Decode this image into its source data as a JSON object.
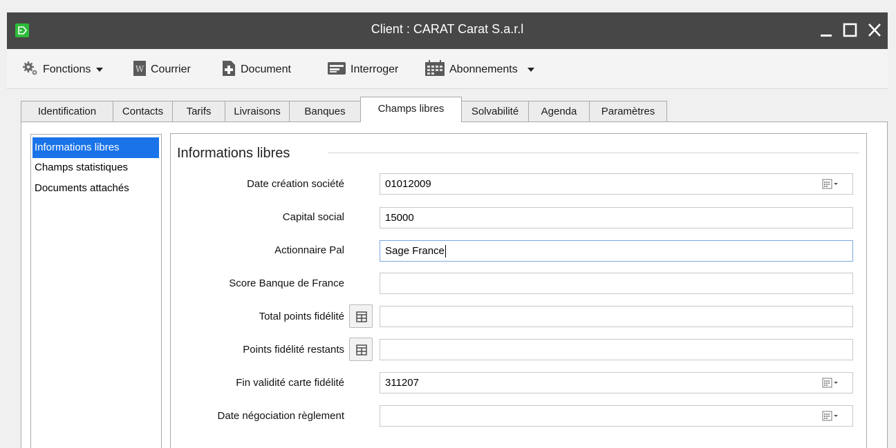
{
  "window": {
    "title": "Client : CARAT Carat S.a.r.l"
  },
  "toolbar": {
    "items": [
      {
        "label": "Fonctions",
        "icon": "gears-icon",
        "dropdown": true
      },
      {
        "label": "Courrier",
        "icon": "word-doc-icon",
        "dropdown": false
      },
      {
        "label": "Document",
        "icon": "new-document-icon",
        "dropdown": false
      },
      {
        "label": "Interroger",
        "icon": "query-icon",
        "dropdown": false
      },
      {
        "label": "Abonnements",
        "icon": "calendar-subscriptions-icon",
        "dropdown": true
      }
    ]
  },
  "tabs": [
    {
      "label": "Identification",
      "active": false
    },
    {
      "label": "Contacts",
      "active": false
    },
    {
      "label": "Tarifs",
      "active": false
    },
    {
      "label": "Livraisons",
      "active": false
    },
    {
      "label": "Banques",
      "active": false
    },
    {
      "label": "Champs libres",
      "active": true
    },
    {
      "label": "Solvabilité",
      "active": false
    },
    {
      "label": "Agenda",
      "active": false
    },
    {
      "label": "Paramètres",
      "active": false
    }
  ],
  "side_list": [
    {
      "label": "Informations libres",
      "selected": true
    },
    {
      "label": "Champs statistiques",
      "selected": false
    },
    {
      "label": "Documents attachés",
      "selected": false
    }
  ],
  "panel": {
    "group_title": "Informations libres",
    "fields": [
      {
        "label": "Date création société",
        "value": "01012009",
        "type": "date"
      },
      {
        "label": "Capital social",
        "value": "15000",
        "type": "text"
      },
      {
        "label": "Actionnaire Pal",
        "value": "Sage France",
        "type": "text",
        "focused": true
      },
      {
        "label": "Score Banque de France",
        "value": "",
        "type": "text"
      },
      {
        "label": "Total points fidélité",
        "value": "",
        "type": "calc"
      },
      {
        "label": "Points fidélité restants",
        "value": "",
        "type": "calc"
      },
      {
        "label": "Fin validité carte fidélité",
        "value": "311207",
        "type": "date"
      },
      {
        "label": "Date négociation règlement",
        "value": "",
        "type": "date"
      }
    ]
  },
  "colors": {
    "titlebar": "#474747",
    "selection": "#1a73e8",
    "app_icon": "#2dbb3a"
  }
}
